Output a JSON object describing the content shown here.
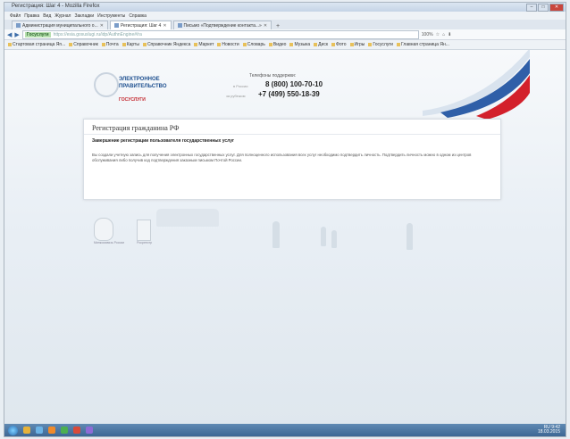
{
  "window": {
    "title": "Регистрация: Шаг 4 - Mozilla Firefox",
    "controls": [
      "–",
      "□",
      "✕"
    ]
  },
  "menubar": {
    "items": [
      "Файл",
      "Правка",
      "Вид",
      "Журнал",
      "Закладки",
      "Инструменты",
      "Справка"
    ]
  },
  "tabs": [
    {
      "label": "Администрация муниципального о...",
      "active": false
    },
    {
      "label": "Регистрация: Шаг 4",
      "active": true
    },
    {
      "label": "Письмо «Подтверждение контакта...»",
      "active": false
    }
  ],
  "tab_new_label": "+",
  "navbar": {
    "back": "◀",
    "forward": "▶",
    "site_badge": "Госуслуги",
    "url": "https://esia.gosuslugi.ru/idp/AuthnEngine#/ra",
    "zoom": "100%",
    "tools": [
      "☆",
      "⌂",
      "⬇"
    ]
  },
  "bookmarks": [
    "Стартовая страница Яn...",
    "Справочник",
    "Почта",
    "Карты",
    "Справочник Яндекса",
    "Маркет",
    "Новости",
    "Словарь",
    "Видео",
    "Музыка",
    "Диск",
    "Фото",
    "Игры",
    "Госуслуги",
    "Главная страница Ян..."
  ],
  "header": {
    "logo_line1": "ЭЛЕКТРОННОЕ",
    "logo_line2": "ПРАВИТЕЛЬСТВО",
    "logo_sub": "ГОСУСЛУГИ",
    "phones_title": "Телефоны поддержки:",
    "phone1_label": "в России",
    "phone1": "8 (800) 100-70-10",
    "phone2_label": "за рубежом",
    "phone2": "+7 (499) 550-18-39"
  },
  "card": {
    "title": "Регистрация гражданина РФ",
    "subtitle": "Завершение регистрации пользователя государственных услуг",
    "body": "Вы создали учетную запись для получения электронных государственных услуг. Для полноценного использования всех услуг необходимо подтвердить личность. Подтвердить личность можно в одном из центров обслуживания либо получив код подтверждения заказным письмом Почтой России."
  },
  "footer": {
    "emblem_caption": "Минкомсвязь России",
    "emblem2_caption": "Росреестр"
  },
  "taskbar": {
    "time": "9:42",
    "date": "18.03.2015",
    "language": "RU"
  },
  "colors": {
    "brand_blue": "#1d4f8f",
    "brand_red": "#c3262d",
    "taskbar": "#3d6794"
  }
}
